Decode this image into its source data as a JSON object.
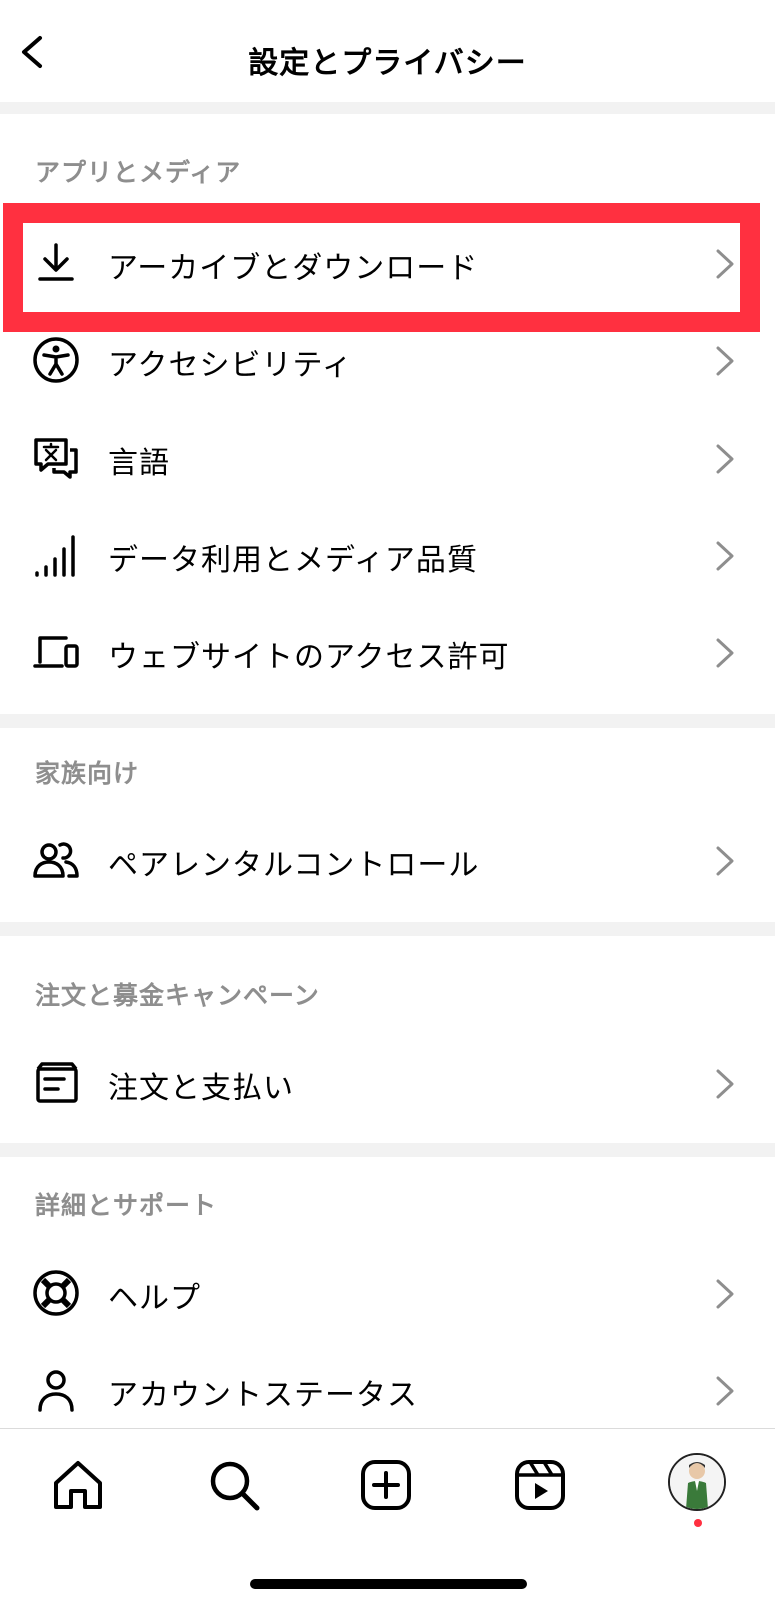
{
  "header": {
    "title": "設定とプライバシー"
  },
  "sections": [
    {
      "header": "アプリとメディア",
      "items": [
        {
          "label": "アーカイブとダウンロード"
        },
        {
          "label": "アクセシビリティ"
        },
        {
          "label": "言語"
        },
        {
          "label": "データ利用とメディア品質"
        },
        {
          "label": "ウェブサイトのアクセス許可"
        }
      ]
    },
    {
      "header": "家族向け",
      "items": [
        {
          "label": "ペアレンタルコントロール"
        }
      ]
    },
    {
      "header": "注文と募金キャンペーン",
      "items": [
        {
          "label": "注文と支払い"
        }
      ]
    },
    {
      "header": "詳細とサポート",
      "items": [
        {
          "label": "ヘルプ"
        },
        {
          "label": "アカウントステータス"
        }
      ]
    }
  ],
  "colors": {
    "highlight": "#ff3040",
    "section_header": "#8e8e8e",
    "chevron": "#8e8e8e",
    "divider": "#f2f2f2"
  },
  "tabbar": {
    "icons": [
      "home-icon",
      "search-icon",
      "create-icon",
      "reels-icon",
      "profile-avatar"
    ]
  }
}
